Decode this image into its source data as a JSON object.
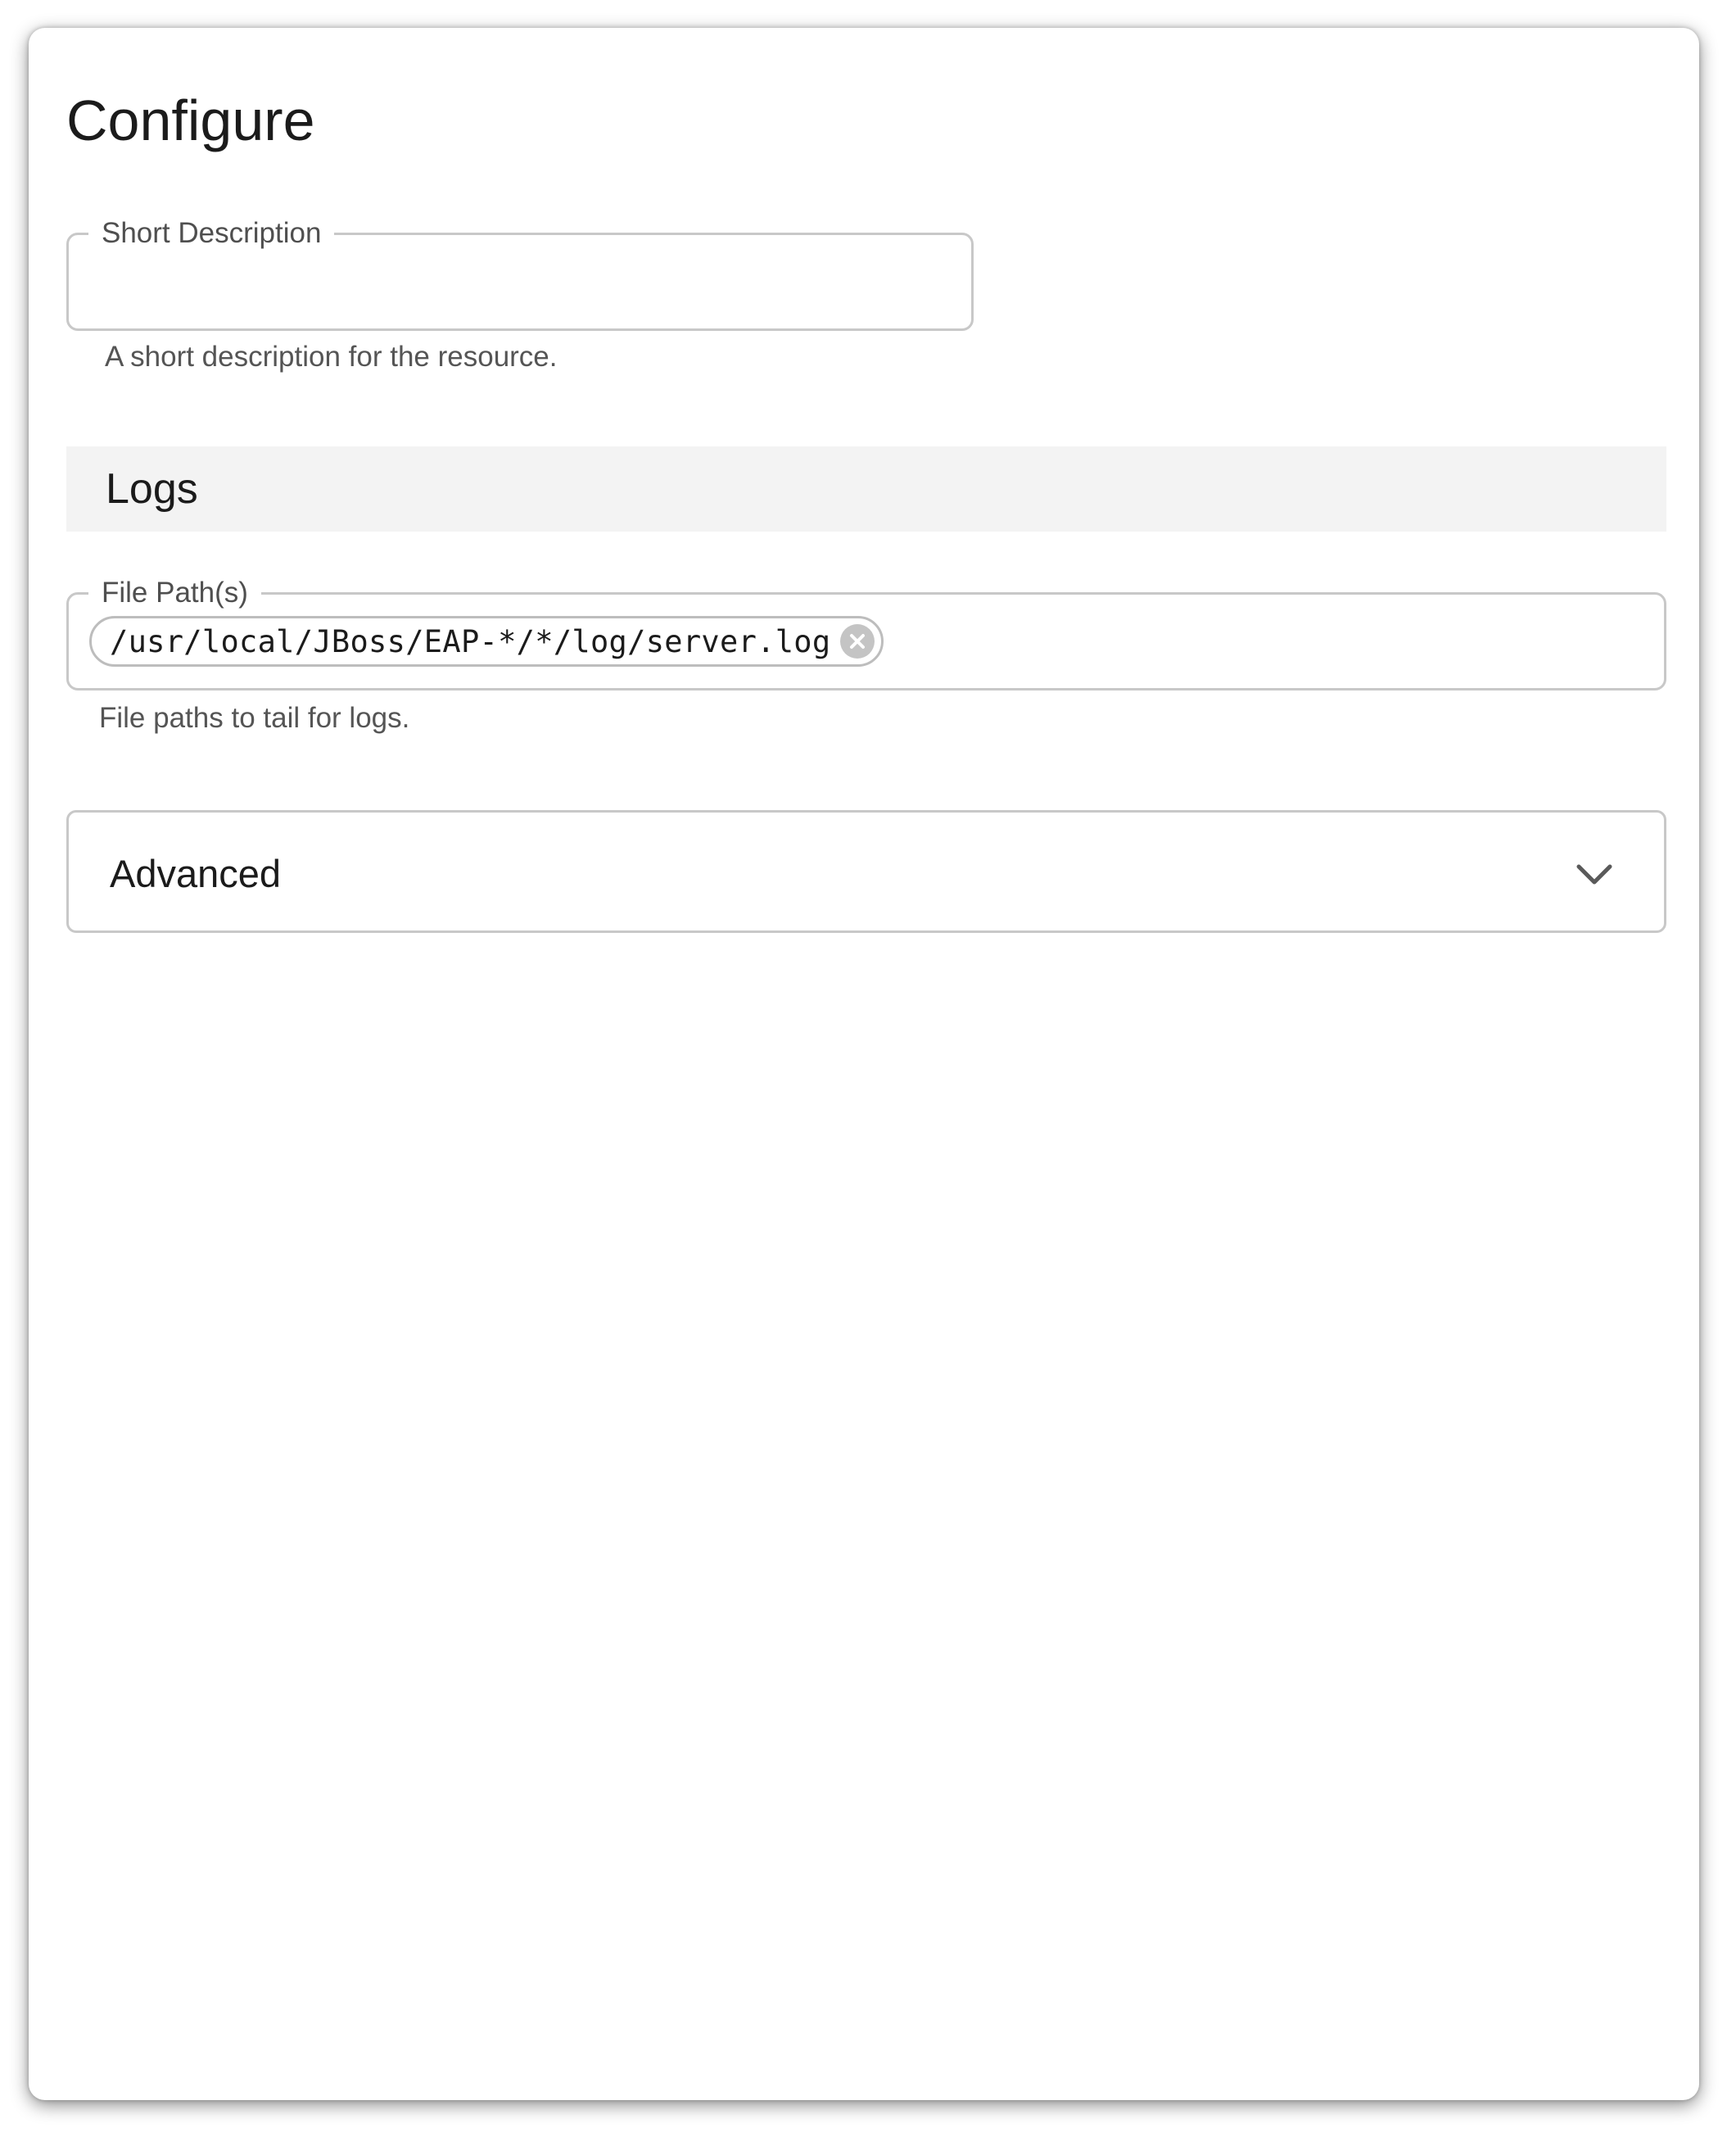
{
  "page": {
    "title": "Configure"
  },
  "short_description": {
    "label": "Short Description",
    "value": "",
    "helper": "A short description for the resource."
  },
  "logs_section": {
    "title": "Logs"
  },
  "file_paths": {
    "label": "File Path(s)",
    "chips": [
      "/usr/local/JBoss/EAP-*/*/log/server.log"
    ],
    "helper": "File paths to tail for logs."
  },
  "advanced": {
    "label": "Advanced",
    "icon": "chevron-down-icon"
  }
}
